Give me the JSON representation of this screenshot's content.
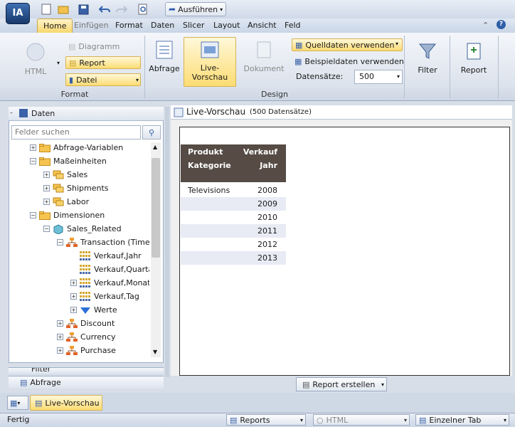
{
  "app": {
    "logo": "IA"
  },
  "quickaccess": {
    "run_label": "Ausführen"
  },
  "tabs": [
    "Home",
    "Einfügen",
    "Format",
    "Daten",
    "Slicer",
    "Layout",
    "Ansicht",
    "Feld"
  ],
  "ribbon": {
    "format_group": {
      "label": "Format",
      "html": "HTML",
      "diagramm": "Diagramm",
      "report": "Report",
      "datei": "Datei"
    },
    "design_group": {
      "label": "Design",
      "abfrage": "Abfrage",
      "live_vorschau": "Live-\nVorschau",
      "dokument": "Dokument",
      "quelldaten": "Quelldaten verwenden",
      "beispieldaten": "Beispieldaten verwenden",
      "datensaetze_label": "Datensätze:",
      "datensaetze_value": "500"
    },
    "filter": "Filter",
    "report_btn": "Report"
  },
  "left_panel": {
    "title": "Daten",
    "search_placeholder": "Felder suchen",
    "tree": [
      {
        "label": "Abfrage-Variablen",
        "level": 1,
        "type": "folder",
        "toggle": "+"
      },
      {
        "label": "Maßeinheiten",
        "level": 1,
        "type": "folder",
        "toggle": "-"
      },
      {
        "label": "Sales",
        "level": 2,
        "type": "measure",
        "toggle": "+"
      },
      {
        "label": "Shipments",
        "level": 2,
        "type": "measure",
        "toggle": "+"
      },
      {
        "label": "Labor",
        "level": 2,
        "type": "measure",
        "toggle": "+"
      },
      {
        "label": "Dimensionen",
        "level": 1,
        "type": "folder",
        "toggle": "-"
      },
      {
        "label": "Sales_Related",
        "level": 2,
        "type": "cube",
        "toggle": "-"
      },
      {
        "label": "Transaction (Time)",
        "level": 3,
        "type": "hierarchy",
        "toggle": "-"
      },
      {
        "label": "Verkauf,Jahr",
        "level": 4,
        "type": "level",
        "toggle": ""
      },
      {
        "label": "Verkauf,Quartal",
        "level": 4,
        "type": "level",
        "toggle": ""
      },
      {
        "label": "Verkauf,Monat",
        "level": 4,
        "type": "level",
        "toggle": "+"
      },
      {
        "label": "Verkauf,Tag",
        "level": 4,
        "type": "level",
        "toggle": "+"
      },
      {
        "label": "Werte",
        "level": 4,
        "type": "filter",
        "toggle": "+"
      },
      {
        "label": "Discount",
        "level": 3,
        "type": "hierarchy",
        "toggle": "+"
      },
      {
        "label": "Currency",
        "level": 3,
        "type": "hierarchy",
        "toggle": "+"
      },
      {
        "label": "Purchase",
        "level": 3,
        "type": "hierarchy",
        "toggle": "+"
      }
    ],
    "bottom_tab_filter": "Filter",
    "bottom_tab_abfrage": "Abfrage"
  },
  "main": {
    "title": "Live-Vorschau",
    "subtitle": "(500 Datensätze)",
    "table": {
      "col1": [
        "Produkt",
        "Kategorie"
      ],
      "col2": [
        "Verkauf",
        "Jahr"
      ],
      "rows": [
        {
          "cat": "Televisions",
          "year": "2008"
        },
        {
          "cat": "",
          "year": "2009"
        },
        {
          "cat": "",
          "year": "2010"
        },
        {
          "cat": "",
          "year": "2011"
        },
        {
          "cat": "",
          "year": "2012"
        },
        {
          "cat": "",
          "year": "2013"
        }
      ]
    },
    "report_erstellen": "Report erstellen"
  },
  "bottom_bar": {
    "live_vorschau_tab": "Live-Vorschau"
  },
  "status": {
    "text": "Fertig",
    "reports": "Reports",
    "html": "HTML",
    "tab": "Einzelner Tab"
  }
}
